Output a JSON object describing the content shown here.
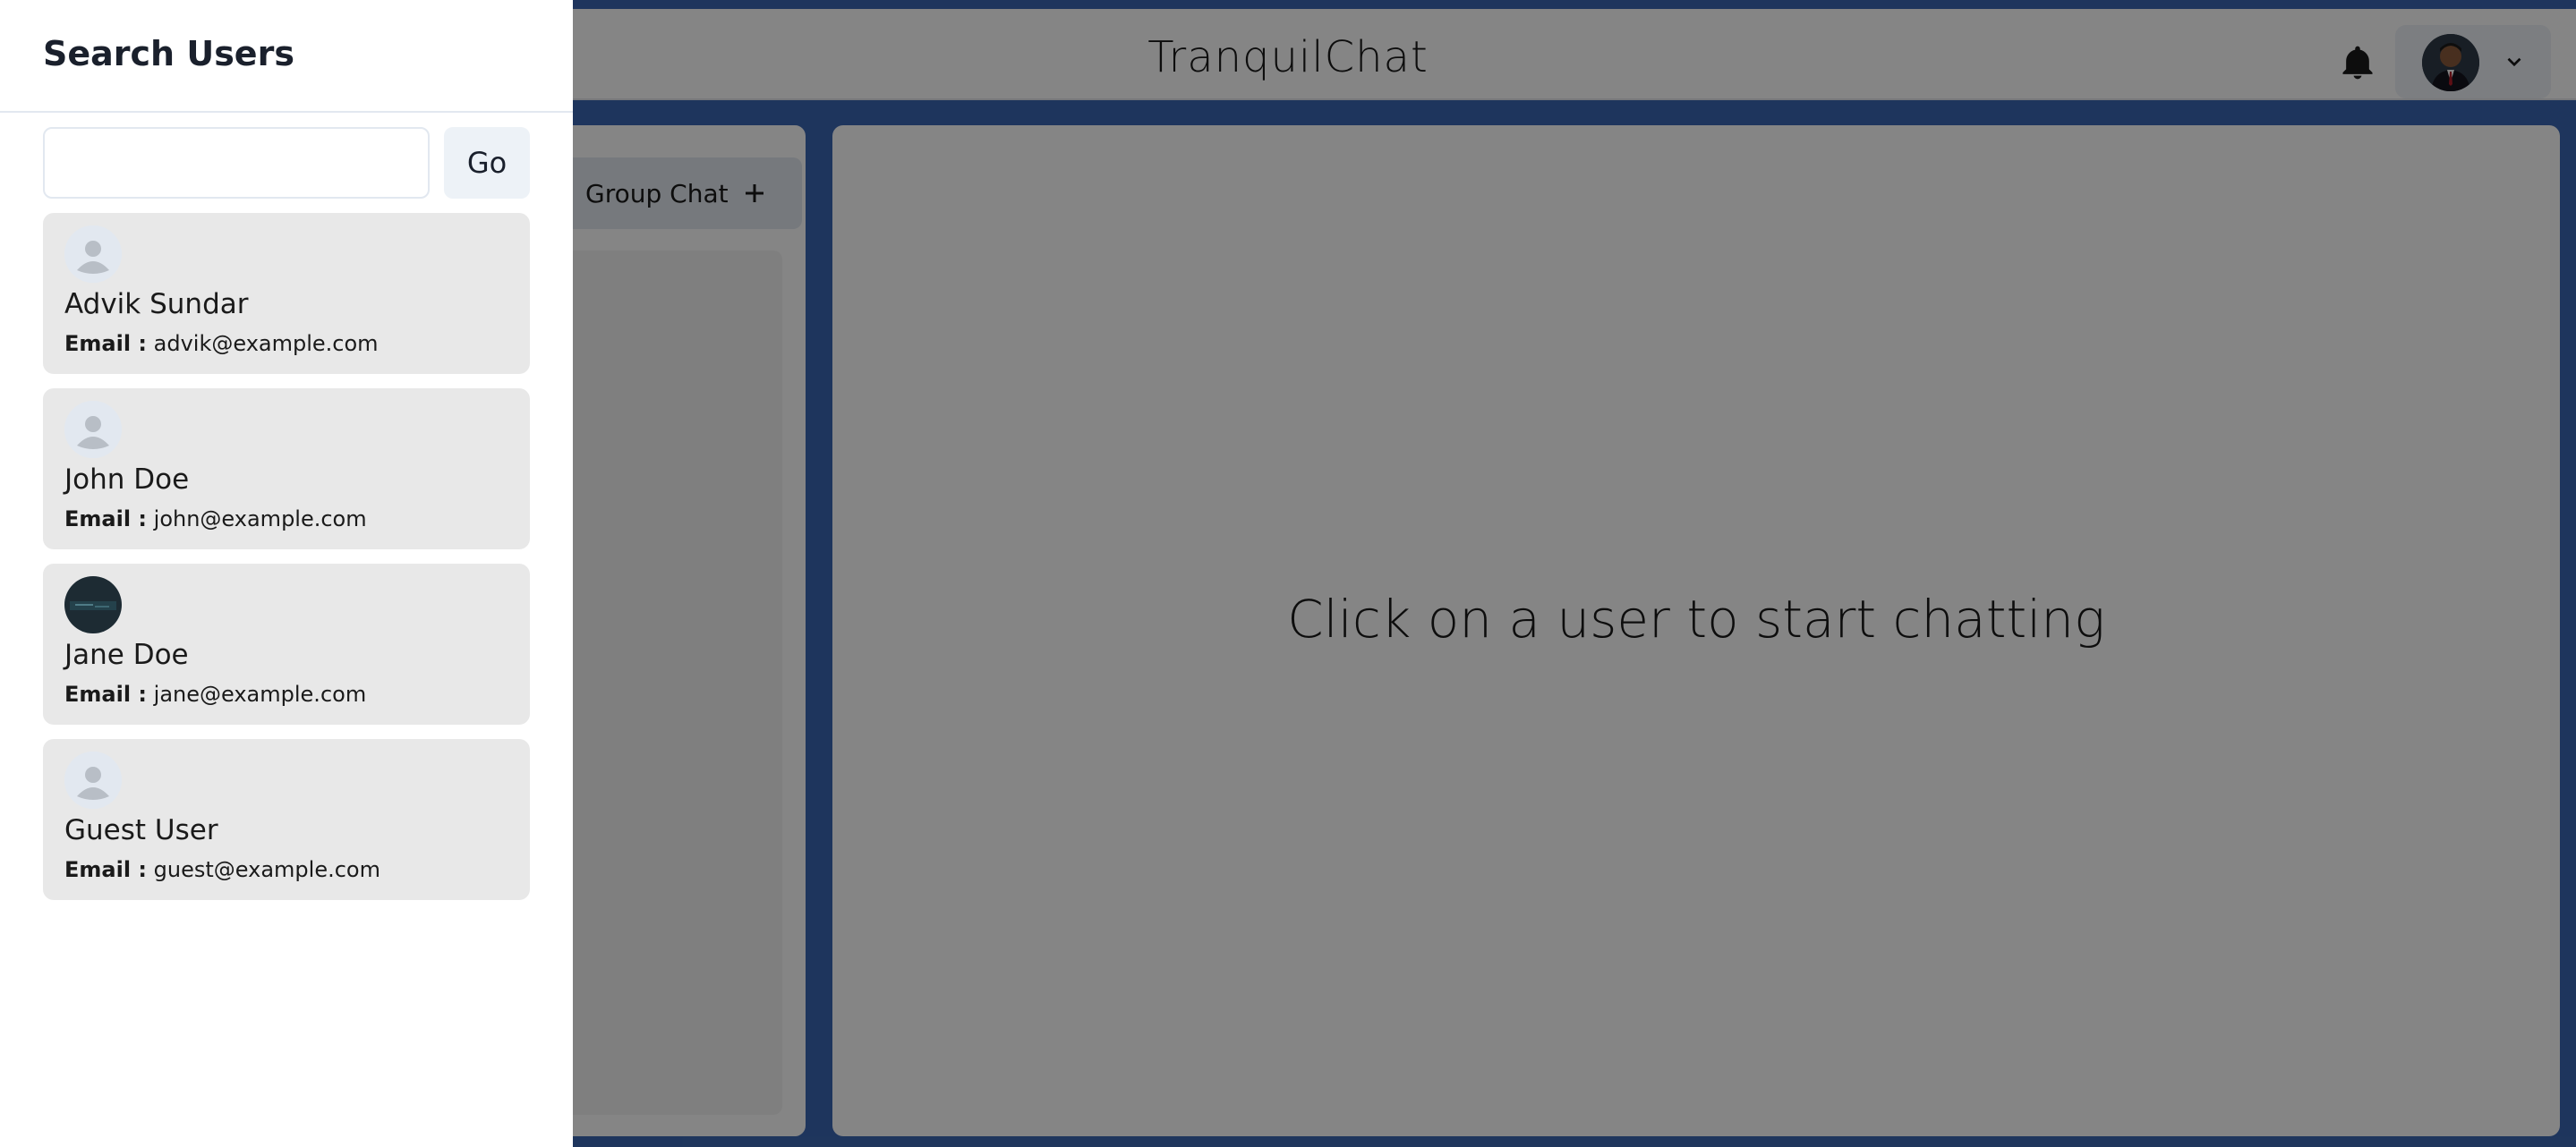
{
  "app": {
    "title": "TranquilChat",
    "new_group_label": "Group Chat",
    "chat_placeholder": "Click on a user to start chatting"
  },
  "drawer": {
    "title": "Search Users",
    "search_value": "",
    "go_label": "Go",
    "email_label": "Email :",
    "users": [
      {
        "name": "Advik Sundar",
        "email": "advik@example.com",
        "avatar": "default-avatar-icon"
      },
      {
        "name": "John Doe",
        "email": "john@example.com",
        "avatar": "default-avatar-icon"
      },
      {
        "name": "Jane Doe",
        "email": "jane@example.com",
        "avatar": "photo-avatar"
      },
      {
        "name": "Guest User",
        "email": "guest@example.com",
        "avatar": "default-avatar-icon"
      }
    ]
  },
  "icons": {
    "notifications": "bell-icon",
    "profile_menu": "chevron-down-icon",
    "add": "plus-icon"
  },
  "colors": {
    "background": "#3b67b3",
    "overlay": "rgba(0,0,0,0.48)",
    "card": "#e8e8e8",
    "button": "#edf2f7"
  }
}
